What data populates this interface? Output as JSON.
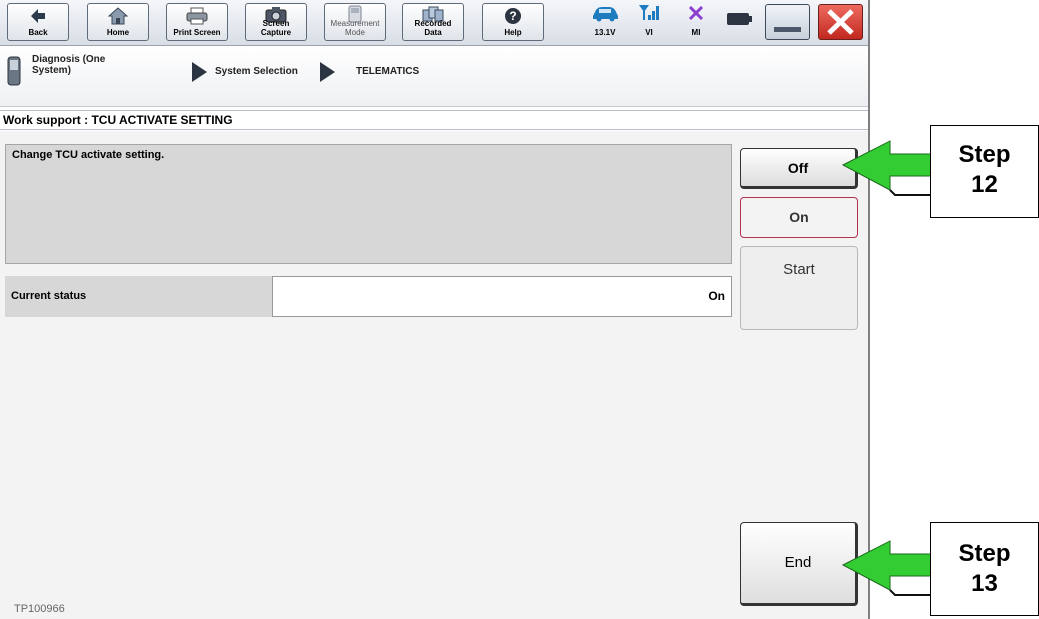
{
  "toolbar": {
    "buttons": [
      {
        "label": "Back",
        "icon": "back-arrow-icon"
      },
      {
        "label": "Home",
        "icon": "home-icon"
      },
      {
        "label": "Print Screen",
        "icon": "printer-icon"
      },
      {
        "label": "Screen\nCapture",
        "icon": "camera-icon"
      },
      {
        "label": "Measurement\nMode",
        "icon": "measurement-icon"
      },
      {
        "label": "Recorded\nData",
        "icon": "recorded-data-icon"
      },
      {
        "label": "Help",
        "icon": "help-icon"
      }
    ],
    "voltage": "13.1V",
    "vi_label": "VI",
    "mi_label": "MI"
  },
  "breadcrumb": {
    "item1": "Diagnosis (One\nSystem)",
    "item2": "System Selection",
    "item3": "TELEMATICS"
  },
  "page_title": "Work support : TCU ACTIVATE SETTING",
  "description": "Change TCU activate setting.",
  "status": {
    "label": "Current status",
    "value": "On"
  },
  "buttons": {
    "off": "Off",
    "on": "On",
    "start": "Start",
    "end": "End"
  },
  "footer_code": "TP100966",
  "callouts": {
    "step12": "Step\n12",
    "step13": "Step\n13"
  },
  "colors": {
    "arrow_fill": "#33cc33",
    "close_red": "#d9302c",
    "on_border": "#b3304e"
  }
}
